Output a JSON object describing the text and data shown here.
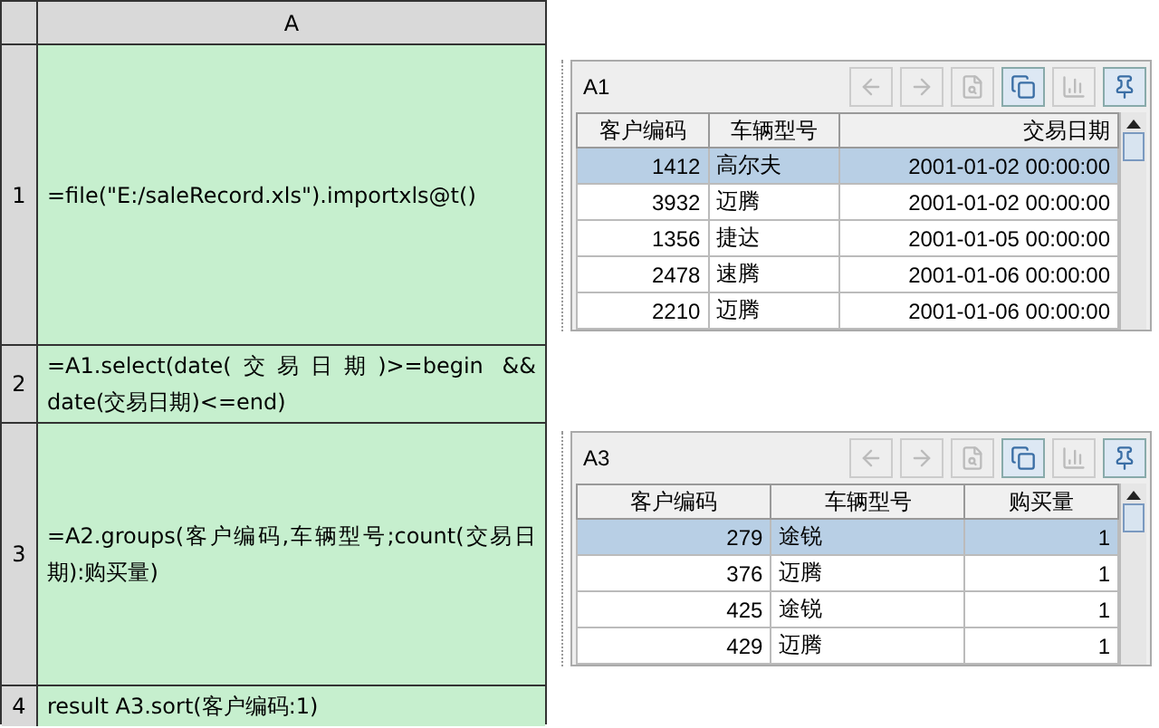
{
  "sheet": {
    "column": "A",
    "rows": [
      {
        "number": "1",
        "formula": "=file(\"E:/saleRecord.xls\").importxls@t()"
      },
      {
        "number": "2",
        "formula": "=A1.select(date(交易日期)>=begin && date(交易日期)<=end)"
      },
      {
        "number": "3",
        "formula": "=A2.groups(客户编码,车辆型号;count(交易日期):购买量)"
      },
      {
        "number": "4",
        "formula": "result A3.sort(客户编码:1)"
      }
    ]
  },
  "panels": [
    {
      "title": "A1",
      "tools": [
        {
          "kind": "back",
          "disabled": true
        },
        {
          "kind": "forward",
          "disabled": true
        },
        {
          "kind": "preview",
          "disabled": true
        },
        {
          "kind": "copy",
          "disabled": false
        },
        {
          "kind": "chart",
          "disabled": true
        },
        {
          "kind": "pin",
          "disabled": false
        }
      ],
      "columns": [
        "客户编码",
        "车辆型号",
        "交易日期"
      ],
      "rows": [
        {
          "selected": true,
          "cells": [
            "1412",
            "高尔夫",
            "2001-01-02 00:00:00"
          ]
        },
        {
          "selected": false,
          "cells": [
            "3932",
            "迈腾",
            "2001-01-02 00:00:00"
          ]
        },
        {
          "selected": false,
          "cells": [
            "1356",
            "捷达",
            "2001-01-05 00:00:00"
          ]
        },
        {
          "selected": false,
          "cells": [
            "2478",
            "速腾",
            "2001-01-06 00:00:00"
          ]
        },
        {
          "selected": false,
          "cells": [
            "2210",
            "迈腾",
            "2001-01-06 00:00:00"
          ]
        }
      ]
    },
    {
      "title": "A3",
      "tools": [
        {
          "kind": "back",
          "disabled": true
        },
        {
          "kind": "forward",
          "disabled": true
        },
        {
          "kind": "preview",
          "disabled": true
        },
        {
          "kind": "copy",
          "disabled": false
        },
        {
          "kind": "chart",
          "disabled": true
        },
        {
          "kind": "pin",
          "disabled": false
        }
      ],
      "columns": [
        "客户编码",
        "车辆型号",
        "购买量"
      ],
      "rows": [
        {
          "selected": true,
          "cells": [
            "279",
            "途锐",
            "1"
          ]
        },
        {
          "selected": false,
          "cells": [
            "376",
            "迈腾",
            "1"
          ]
        },
        {
          "selected": false,
          "cells": [
            "425",
            "途锐",
            "1"
          ]
        },
        {
          "selected": false,
          "cells": [
            "429",
            "迈腾",
            "1"
          ]
        }
      ]
    }
  ]
}
